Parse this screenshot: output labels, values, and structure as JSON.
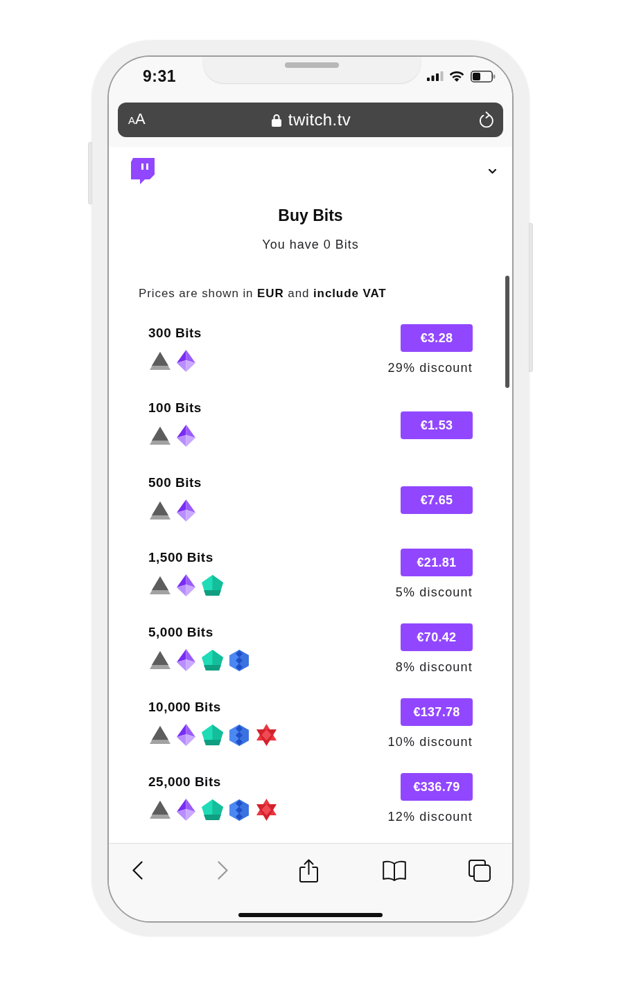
{
  "status_bar": {
    "time": "9:31"
  },
  "address_bar": {
    "text_size_button": "AA",
    "url": "twitch.tv"
  },
  "page": {
    "title": "Buy Bits",
    "balance": "You have 0 Bits",
    "price_note": "Prices are shown in **EUR** and **include VAT**"
  },
  "offers": [
    {
      "amount": "300 Bits",
      "gems": [
        {
          "kind": "triangle"
        },
        {
          "kind": "prism"
        }
      ],
      "price": "€3.28",
      "discount": "29% discount"
    },
    {
      "amount": "100 Bits",
      "gems": [
        {
          "kind": "triangle"
        },
        {
          "kind": "prism"
        }
      ],
      "price": "€1.53"
    },
    {
      "amount": "500 Bits",
      "gems": [
        {
          "kind": "triangle"
        },
        {
          "kind": "prism"
        }
      ],
      "price": "€7.65"
    },
    {
      "amount": "1,500 Bits",
      "gems": [
        {
          "kind": "triangle"
        },
        {
          "kind": "prism"
        },
        {
          "kind": "pentagon"
        }
      ],
      "price": "€21.81",
      "discount": "5% discount"
    },
    {
      "amount": "5,000 Bits",
      "gems": [
        {
          "kind": "triangle"
        },
        {
          "kind": "prism"
        },
        {
          "kind": "pentagon"
        },
        {
          "kind": "hexagon"
        }
      ],
      "price": "€70.42",
      "discount": "8% discount"
    },
    {
      "amount": "10,000 Bits",
      "gems": [
        {
          "kind": "triangle"
        },
        {
          "kind": "prism"
        },
        {
          "kind": "pentagon"
        },
        {
          "kind": "hexagon"
        },
        {
          "kind": "star"
        }
      ],
      "price": "€137.78",
      "discount": "10% discount"
    },
    {
      "amount": "25,000 Bits",
      "gems": [
        {
          "kind": "triangle"
        },
        {
          "kind": "prism"
        },
        {
          "kind": "pentagon"
        },
        {
          "kind": "hexagon"
        },
        {
          "kind": "star"
        }
      ],
      "price": "€336.79",
      "discount": "12% discount"
    }
  ],
  "toolbar": [
    {
      "kind": "back",
      "disabled": false
    },
    {
      "kind": "forward",
      "disabled": true
    },
    {
      "kind": "share",
      "disabled": false
    },
    {
      "kind": "bookmarks",
      "disabled": false
    },
    {
      "kind": "tabs",
      "disabled": false
    }
  ]
}
